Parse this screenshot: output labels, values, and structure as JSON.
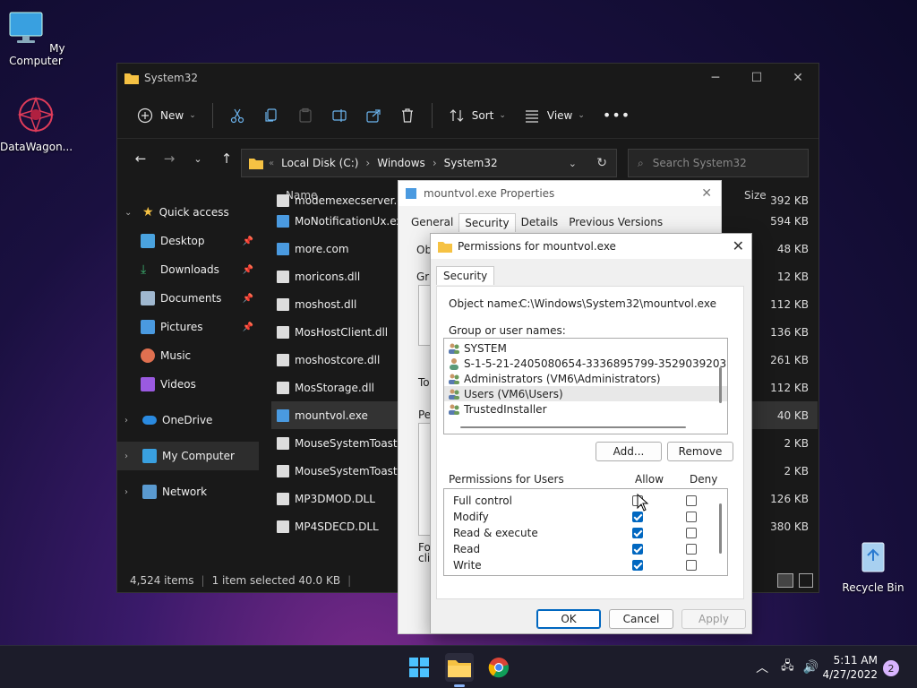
{
  "desktop": {
    "icons": [
      {
        "label": "My Computer"
      },
      {
        "label": "DataWagon..."
      },
      {
        "label": "Recycle Bin"
      }
    ]
  },
  "explorer": {
    "title": "System32",
    "toolbar": {
      "new_label": "New",
      "sort_label": "Sort",
      "view_label": "View"
    },
    "address": {
      "crumbs": [
        "Local Disk (C:)",
        "Windows",
        "System32"
      ]
    },
    "search_placeholder": "Search System32",
    "column_name": "Name",
    "column_size": "Size",
    "sidebar": [
      {
        "label": "Quick access"
      },
      {
        "label": "Desktop"
      },
      {
        "label": "Downloads"
      },
      {
        "label": "Documents"
      },
      {
        "label": "Pictures"
      },
      {
        "label": "Music"
      },
      {
        "label": "Videos"
      },
      {
        "label": "OneDrive"
      },
      {
        "label": "My Computer"
      },
      {
        "label": "Network"
      }
    ],
    "files": [
      {
        "name": "modemexecserver.dll",
        "size": "392 KB"
      },
      {
        "name": "MoNotificationUx.exe",
        "size": "594 KB"
      },
      {
        "name": "more.com",
        "size": "48 KB"
      },
      {
        "name": "moricons.dll",
        "size": "12 KB"
      },
      {
        "name": "moshost.dll",
        "size": "112 KB"
      },
      {
        "name": "MosHostClient.dll",
        "size": "136 KB"
      },
      {
        "name": "moshostcore.dll",
        "size": "261 KB"
      },
      {
        "name": "MosStorage.dll",
        "size": "112 KB"
      },
      {
        "name": "mountvol.exe",
        "size": "40 KB"
      },
      {
        "name": "MouseSystemToastIco",
        "size": "2 KB"
      },
      {
        "name": "MouseSystemToastIco",
        "size": "2 KB"
      },
      {
        "name": "MP3DMOD.DLL",
        "size": "126 KB"
      },
      {
        "name": "MP4SDECD.DLL",
        "size": "380 KB"
      }
    ],
    "status": {
      "items": "4,524 items",
      "selected": "1 item selected  40.0 KB"
    }
  },
  "properties": {
    "title": "mountvol.exe Properties",
    "tabs": [
      "General",
      "Security",
      "Details",
      "Previous Versions"
    ],
    "fragments": [
      "Ob",
      "Gr",
      "To",
      "Pe",
      "For",
      "clic"
    ]
  },
  "permissions": {
    "title": "Permissions for mountvol.exe",
    "tab": "Security",
    "object_label": "Object name:",
    "object_value": "C:\\Windows\\System32\\mountvol.exe",
    "group_label": "Group or user names:",
    "users": [
      {
        "name": "SYSTEM"
      },
      {
        "name": "S-1-5-21-2405080654-3336895799-3529039203"
      },
      {
        "name": "Administrators (VM6\\Administrators)"
      },
      {
        "name": "Users (VM6\\Users)"
      },
      {
        "name": "TrustedInstaller"
      }
    ],
    "add_label": "Add...",
    "remove_label": "Remove",
    "perms_label": "Permissions for Users",
    "allow_label": "Allow",
    "deny_label": "Deny",
    "perms": [
      {
        "name": "Full control",
        "allow": false,
        "deny": false
      },
      {
        "name": "Modify",
        "allow": true,
        "deny": false
      },
      {
        "name": "Read & execute",
        "allow": true,
        "deny": false
      },
      {
        "name": "Read",
        "allow": true,
        "deny": false
      },
      {
        "name": "Write",
        "allow": true,
        "deny": false
      }
    ],
    "ok_label": "OK",
    "cancel_label": "Cancel",
    "apply_label": "Apply"
  },
  "taskbar": {
    "time": "5:11 AM",
    "date": "4/27/2022",
    "notifications": "2"
  }
}
